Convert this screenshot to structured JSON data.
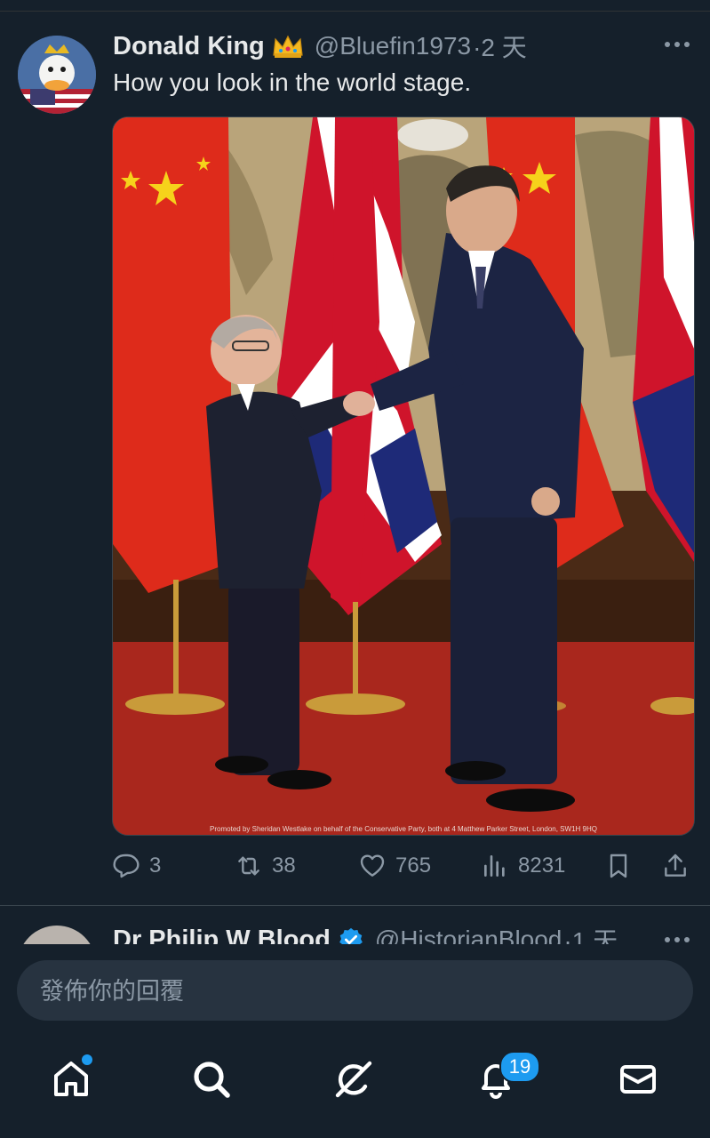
{
  "tweet": {
    "author_name": "Donald King",
    "handle": "@Bluefin1973",
    "time": "·2 天",
    "text": "How you look in the world stage.",
    "media_caption": "Promoted by Sheridan Westlake on behalf of the Conservative Party, both at 4 Matthew Parker Street, London, SW1H 9HQ",
    "actions": {
      "replies": "3",
      "retweets": "38",
      "likes": "765",
      "views": "8231"
    }
  },
  "next_tweet": {
    "author_name": "Dr Philip W Blood",
    "handle": "@HistorianBlood",
    "time": "·1 天"
  },
  "reply": {
    "placeholder": "發佈你的回覆"
  },
  "nav": {
    "notification_count": "19"
  },
  "colors": {
    "background": "#15202b",
    "accent": "#1d9bf0",
    "muted": "#8b98a5"
  }
}
